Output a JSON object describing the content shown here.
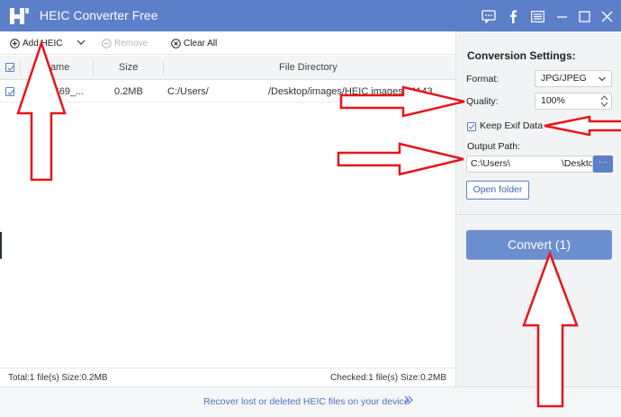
{
  "app": {
    "title": "HEIC Converter Free",
    "accent_color": "#5b7fc8"
  },
  "titlebar_icons": [
    "feedback-icon",
    "facebook-icon",
    "menu-icon",
    "minimize-icon",
    "maximize-icon",
    "close-icon"
  ],
  "toolbar": {
    "add_label": "Add HEIC",
    "remove_label": "Remove",
    "clear_label": "Clear All"
  },
  "table": {
    "columns": [
      "Name",
      "Size",
      "File Directory"
    ],
    "rows": [
      {
        "name": "_1433 669_...",
        "size": "0.2MB",
        "dir_left": "C:/Users/",
        "dir_right": "/Desktop/images/HEIC images/_1143"
      }
    ]
  },
  "status": {
    "total": "Total:1 file(s) Size:0.2MB",
    "checked": "Checked:1 file(s) Size:0.2MB"
  },
  "settings": {
    "title": "Conversion Settings:",
    "format_label": "Format:",
    "format_value": "JPG/JPEG",
    "quality_label": "Quality:",
    "quality_value": "100%",
    "exif_label": "Keep Exif Data",
    "exif_checked": true,
    "output_label": "Output Path:",
    "output_value_left": "C:\\Users\\",
    "output_value_right": "\\Deskto",
    "browse_label": "···",
    "open_folder_label": "Open folder",
    "convert_label": "Convert (1)"
  },
  "footer": {
    "recover_text": "Recover lost or deleted HEIC files on your device",
    "chevron": "»"
  },
  "annotation": {
    "arrow_color": "#e8141b"
  }
}
